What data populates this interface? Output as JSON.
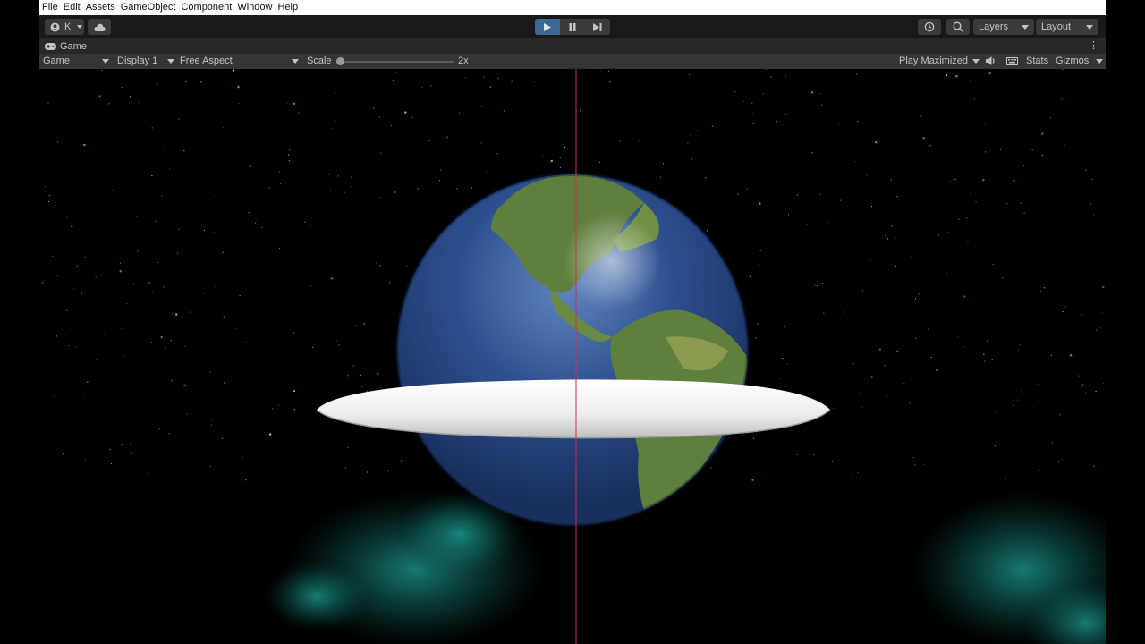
{
  "menubar": {
    "items": [
      "File",
      "Edit",
      "Assets",
      "GameObject",
      "Component",
      "Window",
      "Help"
    ]
  },
  "toolbar": {
    "account_label": "K",
    "layers_label": "Layers",
    "layout_label": "Layout",
    "accent_color": "#3e6795"
  },
  "game_tab": {
    "title": "Game"
  },
  "game_toolbar": {
    "view_select": "Game",
    "display_select": "Display 1",
    "aspect_select": "Free Aspect",
    "scale_label": "Scale",
    "scale_value": "2x",
    "play_mode_select": "Play Maximized",
    "stats_label": "Stats",
    "gizmos_label": "Gizmos"
  },
  "scene": {
    "background_color": "#000000",
    "nebula_color": "#1fa39a",
    "earth_ocean_color": "#2d4f8f",
    "ring_color": "#f2f2f2",
    "center_line_color": "#d0304a"
  }
}
